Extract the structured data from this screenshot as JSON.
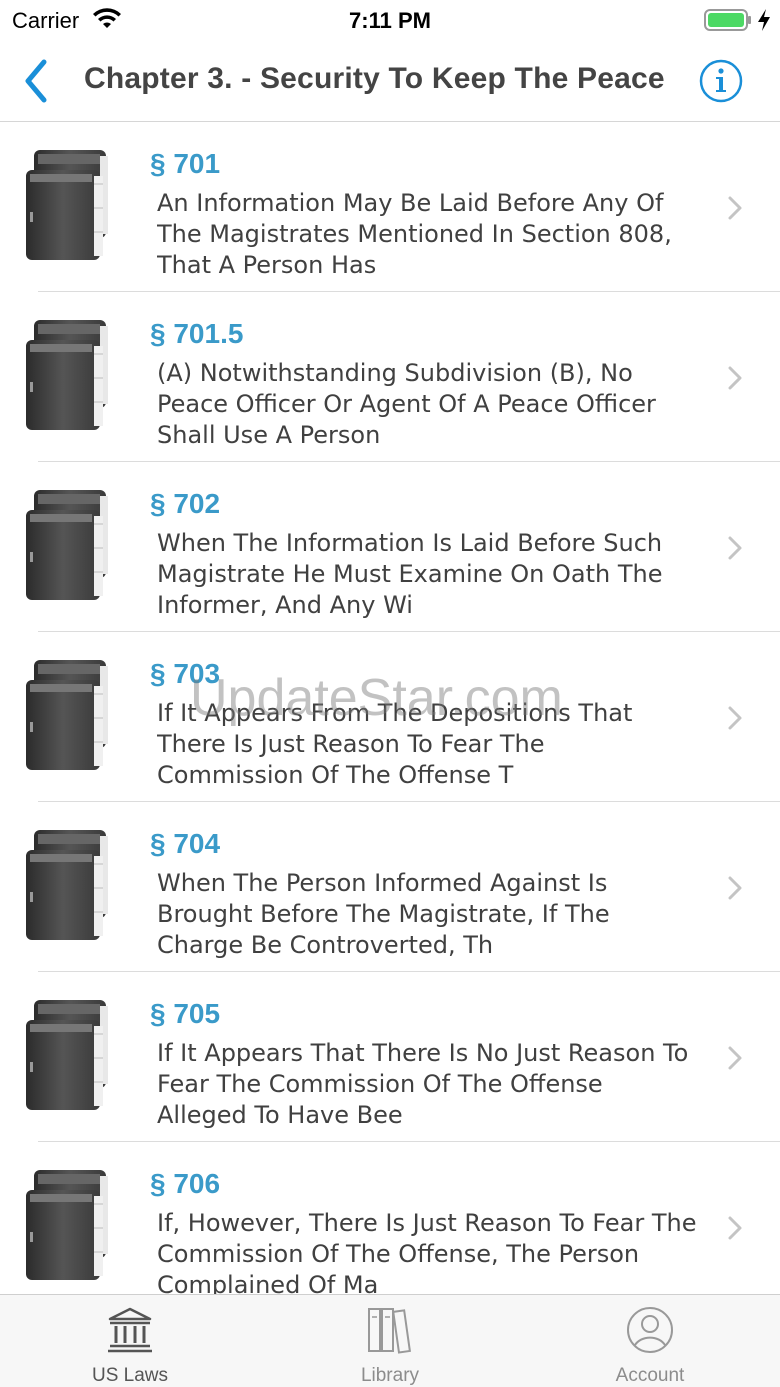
{
  "status_bar": {
    "carrier": "Carrier",
    "time": "7:11 PM"
  },
  "nav": {
    "title": "Chapter  3.  -  Security To Keep The Peace",
    "back_icon": "chevron-left-icon",
    "info_icon": "info-circle-icon"
  },
  "sections": [
    {
      "number": "§ 701",
      "description": "An Information May Be Laid Before Any Of The Magistrates Mentioned In Section 808, That A Person Has"
    },
    {
      "number": "§ 701.5",
      "description": "(A) Notwithstanding Subdivision (B), No Peace Officer Or Agent Of A Peace Officer Shall Use A Person"
    },
    {
      "number": "§ 702",
      "description": "When The Information Is Laid Before Such Magistrate He Must Examine On Oath The Informer, And Any Wi"
    },
    {
      "number": "§ 703",
      "description": "If It Appears From The Depositions That There Is Just Reason To Fear The Commission Of The Offense T"
    },
    {
      "number": "§ 704",
      "description": "When The Person Informed Against Is Brought Before The Magistrate, If The Charge Be Controverted, Th"
    },
    {
      "number": "§ 705",
      "description": "If It Appears That There Is No Just Reason To Fear The Commission Of The Offense Alleged To Have Bee"
    },
    {
      "number": "§ 706",
      "description": "If, However, There Is Just Reason To Fear The Commission Of The Offense, The Person Complained Of Ma"
    }
  ],
  "watermark": "UpdateStar.com",
  "tabs": [
    {
      "label": "US Laws",
      "icon": "courthouse-icon",
      "active": true
    },
    {
      "label": "Library",
      "icon": "books-icon",
      "active": false
    },
    {
      "label": "Account",
      "icon": "user-circle-icon",
      "active": false
    }
  ],
  "colors": {
    "accent": "#3a9ac9",
    "ios_blue": "#1a8fd8",
    "battery": "#4cd964"
  }
}
